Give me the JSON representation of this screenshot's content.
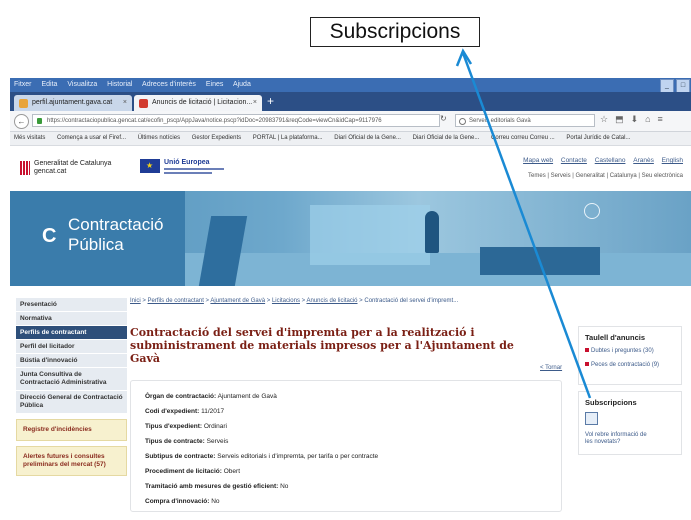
{
  "callout": {
    "label": "Subscripcions"
  },
  "browser": {
    "menu": [
      "Fitxer",
      "Edita",
      "Visualitza",
      "Historial",
      "Adreces d'interès",
      "Eines",
      "Ajuda"
    ],
    "tabs": [
      {
        "label": "perfil.ajuntament.gava.cat"
      },
      {
        "label": "Anuncis de licitació | Licitacion..."
      }
    ],
    "url": "https://contractaciopublica.gencat.cat/ecofin_pscp/AppJava/notice.pscp?idDoc=20983791&reqCode=viewCn&idCap=9117976",
    "search_value": "Serveis editorials Gavà",
    "bookmarks": [
      "Més visitats",
      "Comença a usar el Firef...",
      "Últimes notícies",
      "Gestor Expedients",
      "PORTAL | La plataforma...",
      "Diari Oficial de la Gene...",
      "Diari Oficial de la Gene...",
      "Correu correu Correu ...",
      "Portal Jurídic de Catal..."
    ]
  },
  "site": {
    "gencat_name_1": "Generalitat de Catalunya",
    "gencat_name_2": "gencat.cat",
    "eu_name": "Unió Europea",
    "toplinks": [
      "Mapa web",
      "Contacte",
      "Castellano",
      "Aranès",
      "English"
    ],
    "toplinks2": "Temes | Serveis | Generalitat | Catalunya | Seu electrònica",
    "banner_title_1": "Contractació",
    "banner_title_2": "Pública"
  },
  "sidebar": {
    "items": [
      {
        "label": "Presentació",
        "active": false
      },
      {
        "label": "Normativa",
        "active": false
      },
      {
        "label": "Perfils de contractant",
        "active": true
      },
      {
        "label": "Perfil del licitador",
        "active": false
      },
      {
        "label": "Bústia d'innovació",
        "active": false
      }
    ],
    "blocks": [
      "Junta Consultiva de Contractació Administrativa",
      "Direcció General de Contractació Pública"
    ],
    "box1": "Registre d'incidències",
    "box2": "Alertes futures i consultes preliminars del mercat (57)"
  },
  "breadcrumb": [
    "Inici",
    "Perfils de contractant",
    "Ajuntament de Gavà",
    "Licitacions",
    "Anuncis de licitació",
    "Contractació del servei d'impremt..."
  ],
  "page_title": "Contractació del servei d'impremta per a la realització i subministrament de materials impresos per a l'Ajuntament de Gavà",
  "tornar": "< Tornar",
  "details": [
    {
      "label": "Òrgan de contractació:",
      "value": "Ajuntament de Gavà"
    },
    {
      "label": "Codi d'expedient:",
      "value": "11/2017"
    },
    {
      "label": "Tipus d'expedient:",
      "value": "Ordinari"
    },
    {
      "label": "Tipus de contracte:",
      "value": "Serveis"
    },
    {
      "label": "Subtipus de contracte:",
      "value": "Serveis editorials i d'impremta, per tarifa o per contracte"
    },
    {
      "label": "Procediment de licitació:",
      "value": "Obert"
    },
    {
      "label": "Tramitació amb mesures de gestió eficient:",
      "value": "No"
    },
    {
      "label": "Compra d'innovació:",
      "value": "No"
    }
  ],
  "taulell": {
    "title": "Taulell d'anuncis",
    "items": [
      "Dubtes i preguntes (30)",
      "Peces de contractació (9)"
    ]
  },
  "subscripcions": {
    "title": "Subscripcions",
    "text": "Vol rebre informació de les novetats?"
  },
  "colors": {
    "accent": "#2e4f7a",
    "title": "#7a1f14",
    "arrow": "#1a8ad4"
  }
}
